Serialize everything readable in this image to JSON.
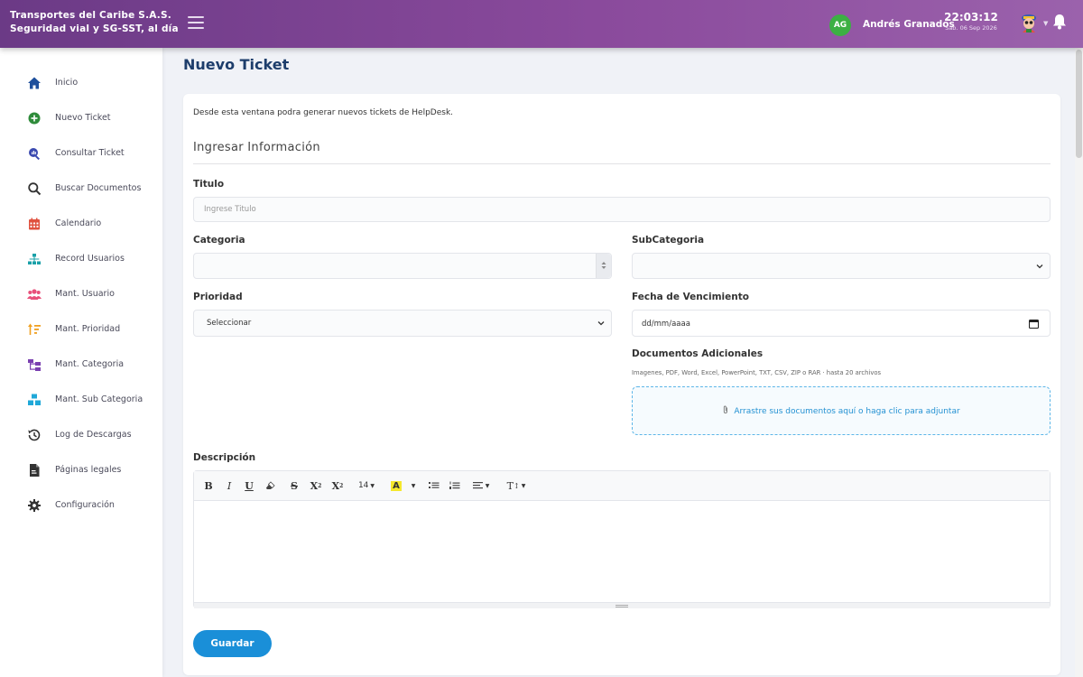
{
  "header": {
    "brand_line1": "Transportes del Caribe S.A.S.",
    "brand_line2": "Seguridad vial y SG-SST, al día",
    "avatar_initials": "AG",
    "user_name": "Andrés Granados",
    "time": "22:03:12",
    "date": "Sab. 06 Sep 2026",
    "icons": [
      "menu-icon",
      "app-mascot-icon",
      "bell-icon"
    ]
  },
  "sidebar": {
    "items": [
      {
        "label": "Inicio",
        "icon": "home-icon",
        "color": "#1d4f9c"
      },
      {
        "label": "Nuevo Ticket",
        "icon": "plus-circle-icon",
        "color": "#2e8b3a"
      },
      {
        "label": "Consultar Ticket",
        "icon": "search-chart-icon",
        "color": "#3b4ab0"
      },
      {
        "label": "Buscar Documentos",
        "icon": "search-icon",
        "color": "#333333"
      },
      {
        "label": "Calendario",
        "icon": "calendar-icon",
        "color": "#e0523f"
      },
      {
        "label": "Record Usuarios",
        "icon": "sitemap-icon",
        "color": "#19a0a8"
      },
      {
        "label": "Mant. Usuario",
        "icon": "users-icon",
        "color": "#e8507a"
      },
      {
        "label": "Mant. Prioridad",
        "icon": "sort-priority-icon",
        "color": "#f0a020"
      },
      {
        "label": "Mant. Categoria",
        "icon": "category-tree-icon",
        "color": "#7a3fb0"
      },
      {
        "label": "Mant. Sub Categoria",
        "icon": "cubes-icon",
        "color": "#1fa8d8"
      },
      {
        "label": "Log de Descargas",
        "icon": "history-icon",
        "color": "#333333"
      },
      {
        "label": "Páginas legales",
        "icon": "file-legal-icon",
        "color": "#333333"
      },
      {
        "label": "Configuración",
        "icon": "gear-icon",
        "color": "#333333"
      }
    ]
  },
  "main": {
    "page_title": "Nuevo Ticket",
    "intro": "Desde esta ventana podra generar nuevos tickets de HelpDesk.",
    "section_title": "Ingresar Información",
    "titulo": {
      "label": "Titulo",
      "placeholder": "Ingrese Titulo",
      "value": ""
    },
    "categoria": {
      "label": "Categoria",
      "value": ""
    },
    "subcategoria": {
      "label": "SubCategoria",
      "value": ""
    },
    "prioridad": {
      "label": "Prioridad",
      "value": "Seleccionar"
    },
    "vencimiento": {
      "label": "Fecha de Vencimiento",
      "value": "dd/mm/aaaa"
    },
    "documentos": {
      "label": "Documentos Adicionales",
      "hint": "Imagenes, PDF, Word, Excel, PowerPoint, TXT, CSV, ZIP o RAR · hasta 20 archivos",
      "dropzone_text": "Arrastre sus documentos aquí o haga clic para adjuntar"
    },
    "descripcion": {
      "label": "Descripción",
      "font_size": "14",
      "toolbar": [
        "bold-icon",
        "italic-icon",
        "underline-icon",
        "eraser-icon",
        "strikethrough-icon",
        "superscript-icon",
        "subscript-icon",
        "font-size-dropdown",
        "highlight-color-icon",
        "unordered-list-icon",
        "ordered-list-icon",
        "align-icon",
        "text-height-icon"
      ]
    },
    "save_label": "Guardar"
  },
  "colors": {
    "header_start": "#6b3a86",
    "header_end": "#9b62ac",
    "primary_button": "#1a8fd8",
    "title_blue": "#1d3d6b",
    "avatar_green": "#3cb043",
    "dropzone_border": "#5db6e8"
  }
}
